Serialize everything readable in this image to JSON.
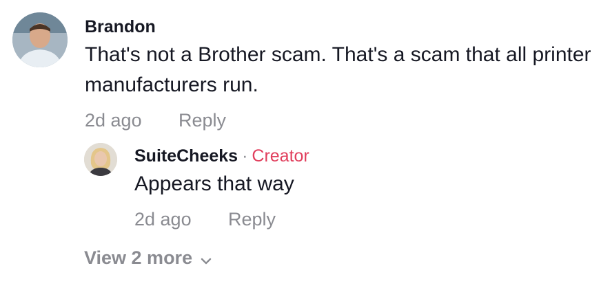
{
  "comments": [
    {
      "username": "Brandon",
      "text": "That's not a Brother scam. That's a scam that all printer manufacturers run.",
      "time": "2d ago",
      "reply_label": "Reply",
      "avatar_icon": "user-avatar"
    }
  ],
  "reply": {
    "username": "SuiteCheeks",
    "separator": "·",
    "badge": "Creator",
    "text": "Appears that way",
    "time": "2d ago",
    "reply_label": "Reply",
    "avatar_icon": "user-avatar"
  },
  "view_more": {
    "label": "View 2 more",
    "icon": "chevron-down-icon"
  },
  "colors": {
    "text": "#161823",
    "secondary": "#8a8b91",
    "creator_badge": "#e13f5d"
  }
}
